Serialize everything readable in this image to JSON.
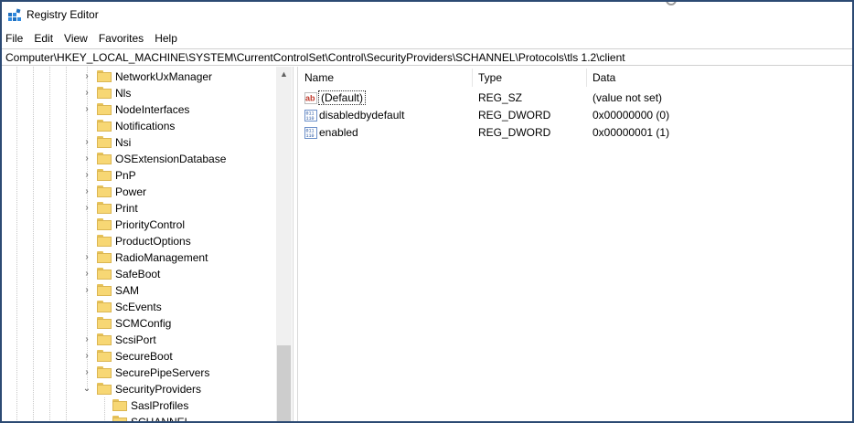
{
  "window": {
    "title": "Registry Editor",
    "app_icon": "registry-editor-icon"
  },
  "menu": [
    "File",
    "Edit",
    "View",
    "Favorites",
    "Help"
  ],
  "address": "Computer\\HKEY_LOCAL_MACHINE\\SYSTEM\\CurrentControlSet\\Control\\SecurityProviders\\SCHANNEL\\Protocols\\tls 1.2\\client",
  "tree": {
    "items": [
      {
        "label": "NetworkUxManager",
        "expander": "collapsed"
      },
      {
        "label": "Nls",
        "expander": "collapsed"
      },
      {
        "label": "NodeInterfaces",
        "expander": "collapsed"
      },
      {
        "label": "Notifications",
        "expander": "none"
      },
      {
        "label": "Nsi",
        "expander": "collapsed"
      },
      {
        "label": "OSExtensionDatabase",
        "expander": "collapsed"
      },
      {
        "label": "PnP",
        "expander": "collapsed"
      },
      {
        "label": "Power",
        "expander": "collapsed"
      },
      {
        "label": "Print",
        "expander": "collapsed"
      },
      {
        "label": "PriorityControl",
        "expander": "none"
      },
      {
        "label": "ProductOptions",
        "expander": "none"
      },
      {
        "label": "RadioManagement",
        "expander": "collapsed"
      },
      {
        "label": "SafeBoot",
        "expander": "collapsed"
      },
      {
        "label": "SAM",
        "expander": "collapsed"
      },
      {
        "label": "ScEvents",
        "expander": "none"
      },
      {
        "label": "SCMConfig",
        "expander": "none"
      },
      {
        "label": "ScsiPort",
        "expander": "collapsed"
      },
      {
        "label": "SecureBoot",
        "expander": "collapsed"
      },
      {
        "label": "SecurePipeServers",
        "expander": "collapsed"
      },
      {
        "label": "SecurityProviders",
        "expander": "expanded"
      },
      {
        "label": "SaslProfiles",
        "expander": "none"
      },
      {
        "label": "SCHANNEL",
        "expander": "expanded"
      }
    ]
  },
  "values": {
    "headers": {
      "name": "Name",
      "type": "Type",
      "data": "Data"
    },
    "rows": [
      {
        "name": "(Default)",
        "type": "REG_SZ",
        "data": "(value not set)",
        "icon": "string-value-icon"
      },
      {
        "name": "disabledbydefault",
        "type": "REG_DWORD",
        "data": "0x00000000 (0)",
        "icon": "binary-value-icon"
      },
      {
        "name": "enabled",
        "type": "REG_DWORD",
        "data": "0x00000001 (1)",
        "icon": "binary-value-icon"
      }
    ]
  },
  "colors": {
    "frame": "#2c4a73",
    "folder": "#f7d774",
    "selection_border": "#333333"
  }
}
